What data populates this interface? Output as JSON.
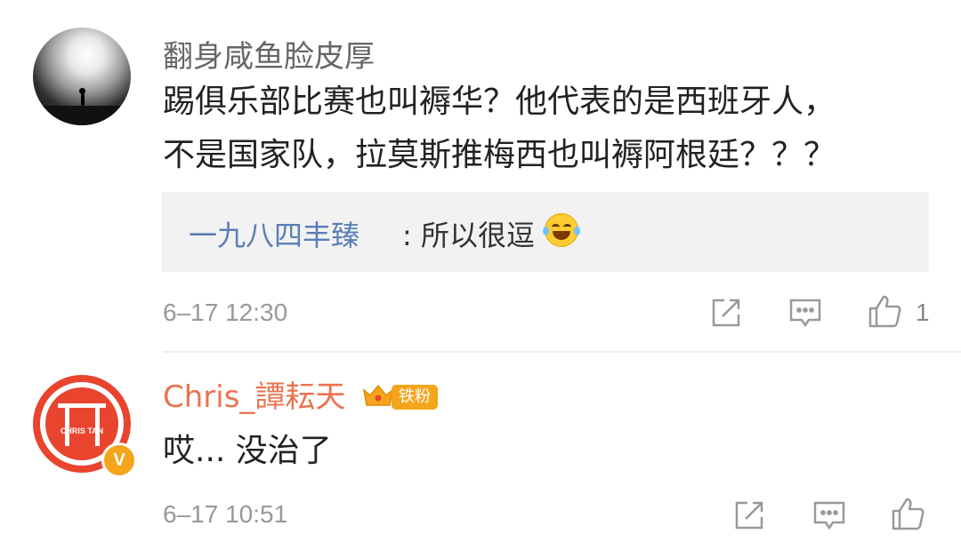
{
  "comments": [
    {
      "username": "翻身咸鱼脸皮厚",
      "text_lines": [
        "踢俱乐部比赛也叫褥华？他代表的是西班牙人，",
        "不是国家队，拉莫斯推梅西也叫褥阿根廷？？？"
      ],
      "reply": {
        "user": "一九八四丰臻",
        "text": ": 所以很逗",
        "emoji": "laughing-crying-emoji"
      },
      "time": "6–17 12:30",
      "like_count": "1"
    },
    {
      "username": "Chris_譚耘天",
      "badge": "铁粉",
      "avatar_text": "CHRIS TAN",
      "verified_badge": "V",
      "text_lines": [
        "哎... 没治了"
      ],
      "time": "6–17 10:51"
    }
  ],
  "colors": {
    "username_orange": "#eb7350",
    "reply_blue": "#5a7fb5",
    "badge_gold": "#f4a51c"
  }
}
